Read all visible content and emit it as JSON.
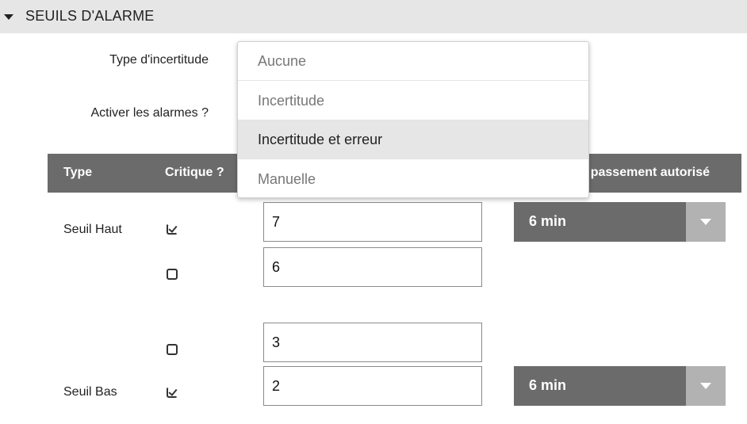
{
  "section": {
    "title": "SEUILS D'ALARME"
  },
  "form": {
    "uncertainty_label": "Type d'incertitude",
    "alarm_label": "Activer les alarmes ?"
  },
  "dropdown": {
    "options": [
      "Aucune",
      "Incertitude",
      "Incertitude et erreur",
      "Manuelle"
    ],
    "selected": "Incertitude et erreur"
  },
  "table": {
    "headers": {
      "type": "Type",
      "critical": "Critique ?",
      "duration": "passement autorisé"
    },
    "rows": [
      {
        "label": "Seuil Haut",
        "critical": true,
        "value": "7",
        "duration": "6 min"
      },
      {
        "label": "",
        "critical": false,
        "value": "6"
      },
      {
        "label": "",
        "critical": false,
        "value": "3"
      },
      {
        "label": "Seuil Bas",
        "critical": true,
        "value": "2",
        "duration": "6 min"
      }
    ]
  },
  "icons": {
    "collapse": "caret-down-icon",
    "checkbox_checked": "checkbox-checked-icon",
    "checkbox_empty": "checkbox-empty-icon",
    "select_arrow": "chevron-down-icon"
  },
  "colors": {
    "header_bg": "#e6e6e6",
    "table_header_bg": "#6b6b6b",
    "select_bg": "#6b6b6b",
    "select_button_bg": "#b2b2b2",
    "option_selected_bg": "#e6e6e6"
  }
}
